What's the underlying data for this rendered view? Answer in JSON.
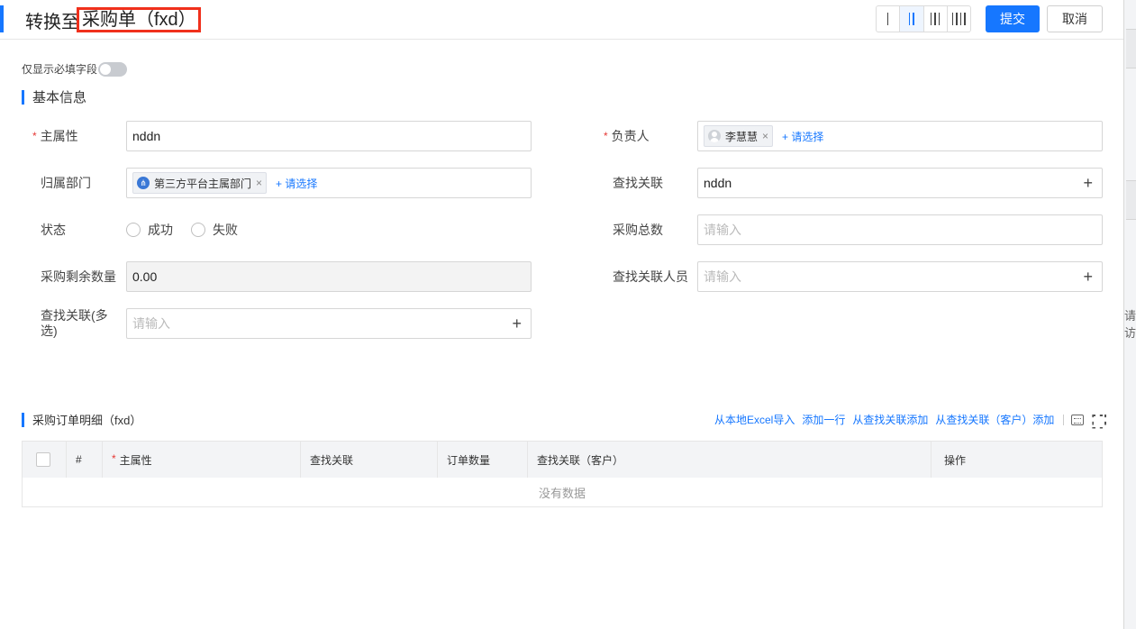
{
  "header": {
    "title_prefix": "转换至",
    "title_highlight": "采购单（fxd）",
    "submit_label": "提交",
    "cancel_label": "取消",
    "layout_options": [
      "1-column",
      "2-column",
      "3-column",
      "4-column"
    ],
    "active_layout": "2-column"
  },
  "toggle": {
    "label": "仅显示必填字段",
    "on": false
  },
  "basic_section": {
    "title": "基本信息"
  },
  "form": {
    "main_attr": {
      "label": "主属性",
      "value": "nddn",
      "required": true
    },
    "owner": {
      "label": "负责人",
      "required": true,
      "tag": "李慧慧",
      "add_label": "+ 请选择"
    },
    "dept": {
      "label": "归属部门",
      "tag": "第三方平台主属部门",
      "add_label": "+ 请选择"
    },
    "lookup": {
      "label": "查找关联",
      "value": "nddn"
    },
    "status": {
      "label": "状态",
      "options": [
        "成功",
        "失败"
      ]
    },
    "purchase_total": {
      "label": "采购总数",
      "placeholder": "请输入"
    },
    "remaining": {
      "label": "采购剩余数量",
      "value": "0.00"
    },
    "lookup_person": {
      "label": "查找关联人员",
      "placeholder": "请输入"
    },
    "lookup_multi": {
      "label_line1": "查找关联(多",
      "label_line2": "选)",
      "placeholder": "请输入"
    }
  },
  "detail_section": {
    "title": "采购订单明细（fxd）",
    "actions": [
      "从本地Excel导入",
      "添加一行",
      "从查找关联添加",
      "从查找关联（客户）添加"
    ],
    "columns": [
      "#",
      "主属性",
      "查找关联",
      "订单数量",
      "查找关联（客户）",
      "操作"
    ],
    "empty_text": "没有数据"
  },
  "right_strip": {
    "text": "请访"
  },
  "colors": {
    "accent": "#1677ff",
    "required": "#e53935",
    "highlight_box": "#f0301c"
  }
}
